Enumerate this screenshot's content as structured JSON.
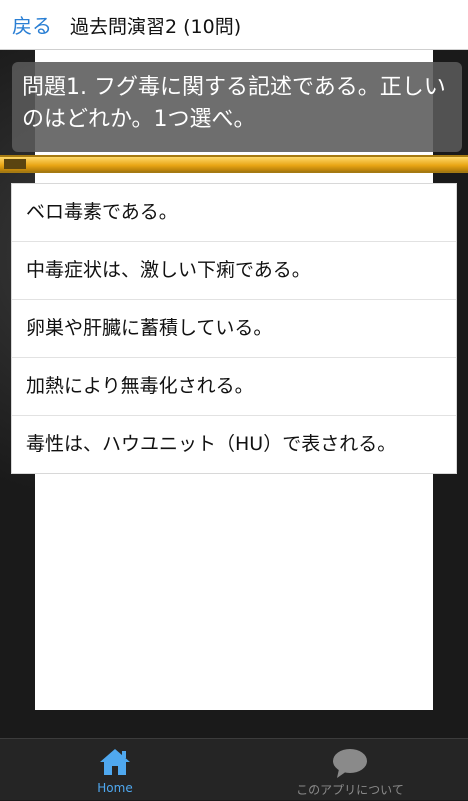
{
  "header": {
    "back_label": "戻る",
    "title": "過去問演習2 (10問)"
  },
  "question": {
    "text": "問題1. フグ毒に関する記述である。正しいのはどれか。1つ選べ。"
  },
  "progress": {
    "fraction": 1.0
  },
  "choices": [
    {
      "label": "ベロ毒素である。"
    },
    {
      "label": "中毒症状は、激しい下痢である。"
    },
    {
      "label": "卵巣や肝臓に蓄積している。"
    },
    {
      "label": "加熱により無毒化される。"
    },
    {
      "label": "毒性は、ハウユニット（HU）で表される。"
    }
  ],
  "bottom_nav": {
    "tabs": [
      {
        "label": "Home",
        "icon": "home-icon",
        "active": true
      },
      {
        "label": "このアプリについて",
        "icon": "speech-bubble-icon",
        "active": false
      }
    ]
  },
  "colors": {
    "accent": "#4fa8ef",
    "back_link": "#2a7fd4",
    "progress": "#e8a514"
  }
}
